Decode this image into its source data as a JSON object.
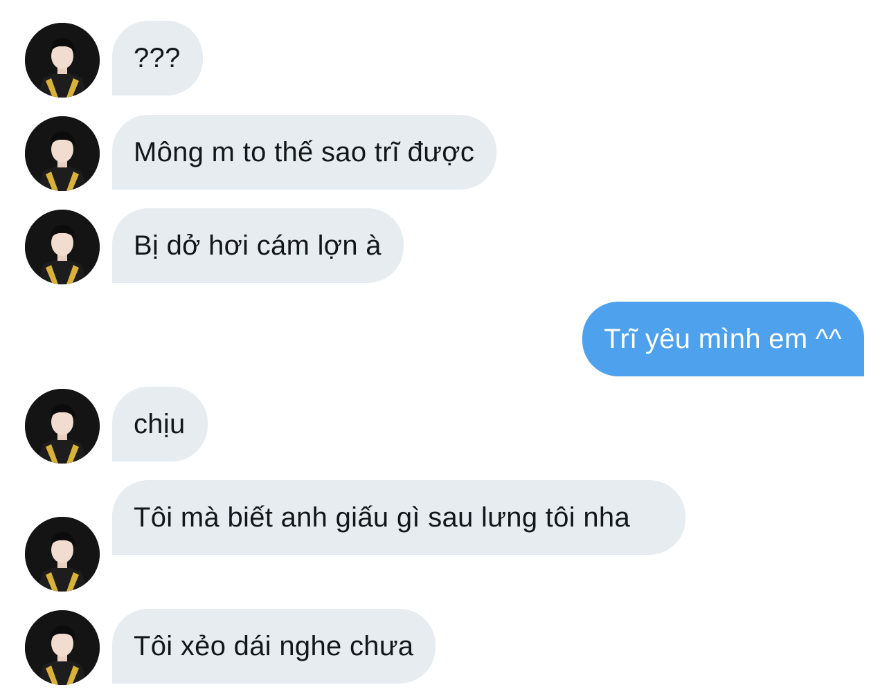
{
  "conversation": {
    "messages": [
      {
        "sender": "other",
        "text": "???"
      },
      {
        "sender": "other",
        "text": "Mông m to thế sao trĩ được"
      },
      {
        "sender": "other",
        "text": "Bị dở hơi cám lợn à"
      },
      {
        "sender": "me",
        "text": "Trĩ yêu mình em ^^"
      },
      {
        "sender": "other",
        "text": "chịu"
      },
      {
        "sender": "other",
        "text": "Tôi mà biết anh giấu gì sau lưng tôi nha"
      },
      {
        "sender": "other",
        "text": "Tôi xẻo dái nghe chưa"
      }
    ]
  },
  "colors": {
    "incoming_bubble": "#e6ecf0",
    "outgoing_bubble": "#4ea1ec",
    "incoming_text": "#14171a",
    "outgoing_text": "#ffffff"
  },
  "icons": {
    "avatar": "contact-avatar-photo"
  }
}
